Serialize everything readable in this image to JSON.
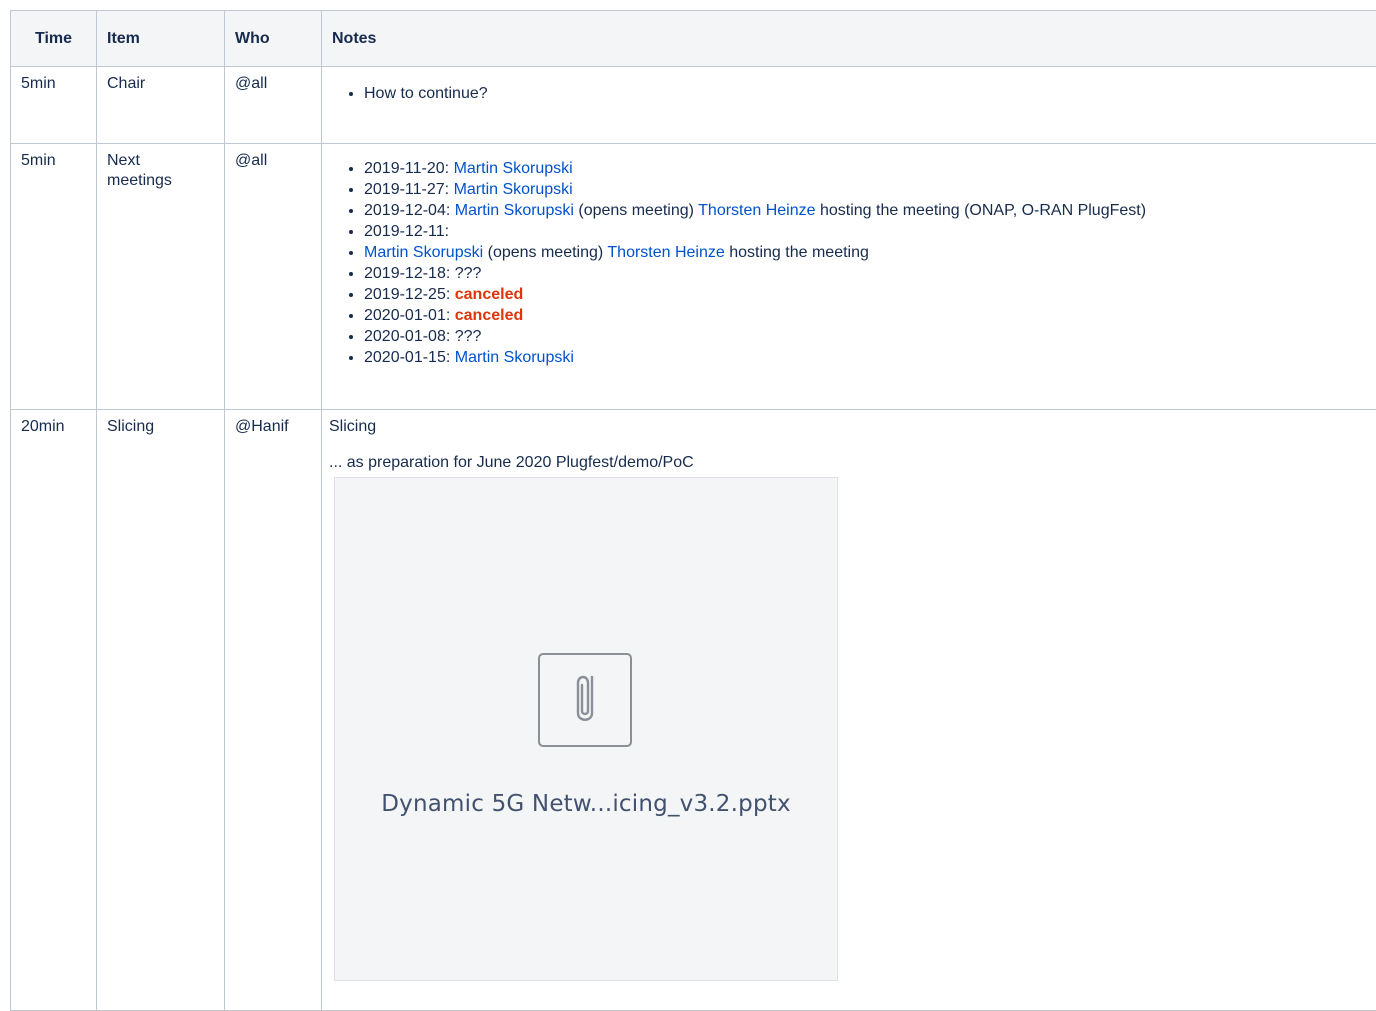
{
  "table": {
    "headers": [
      "Time",
      "Item",
      "Who",
      "Notes"
    ],
    "rows": [
      {
        "time": "5min",
        "item": "Chair",
        "who": "@all",
        "notes": [
          "How to continue?"
        ]
      },
      {
        "time": "5min",
        "item": "Next meetings",
        "who": "@all",
        "meetings": [
          {
            "date": "2019-11-20:",
            "user": "Martin Skorupski"
          },
          {
            "date": "2019-11-27:",
            "user": "Martin Skorupski"
          },
          {
            "date": "2019-12-04:",
            "user": "Martin Skorupski",
            "mid": "(opens meeting)",
            "user2": "Thorsten Heinze",
            "tail": "hosting the meeting (ONAP, O-RAN PlugFest)"
          },
          {
            "date": "2019-12-11:"
          },
          {
            "user": "Martin Skorupski",
            "mid": "(opens meeting)",
            "user2": "Thorsten Heinze",
            "tail": "hosting the meeting"
          },
          {
            "date": "2019-12-18:",
            "tail": "???"
          },
          {
            "date": "2019-12-25:",
            "status": "canceled"
          },
          {
            "date": "2020-01-01:",
            "status": "canceled"
          },
          {
            "date": "2020-01-08:",
            "tail": "???"
          },
          {
            "date": "2020-01-15:",
            "user": "Martin Skorupski"
          }
        ]
      },
      {
        "time": "20min",
        "item": "Slicing",
        "who": "@Hanif",
        "heading": "Slicing",
        "subtitle": "... as preparation for June 2020 Plugfest/demo/PoC",
        "attachment": {
          "name": "Dynamic 5G Netw...icing_v3.2.pptx",
          "icon": "paperclip-icon"
        }
      }
    ]
  },
  "colors": {
    "link": "#0052cc",
    "cancel": "#de350b",
    "border": "#c1c7d0",
    "header_bg": "#f4f5f7"
  }
}
